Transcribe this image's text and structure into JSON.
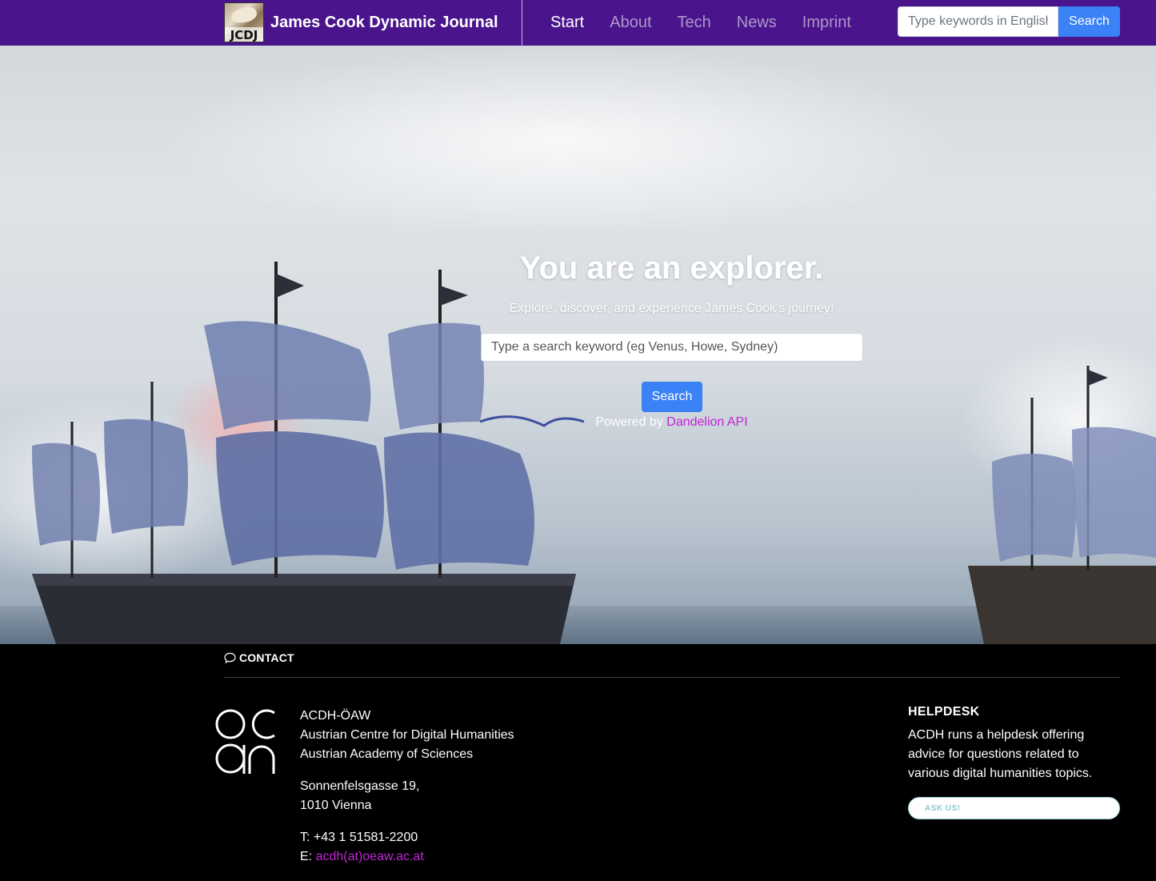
{
  "navbar": {
    "brand_title": "James Cook Dynamic Journal",
    "logo_text": "JCDJ",
    "links": [
      {
        "label": "Start",
        "active": true
      },
      {
        "label": "About",
        "active": false
      },
      {
        "label": "Tech",
        "active": false
      },
      {
        "label": "News",
        "active": false
      },
      {
        "label": "Imprint",
        "active": false
      }
    ],
    "search_placeholder": "Type keywords in English",
    "search_button": "Search",
    "background_color": "#4a148c",
    "button_color": "#3b82f6"
  },
  "hero": {
    "title": "You are an explorer.",
    "subtitle": "Explore, discover, and experience James Cook's journey!",
    "search_placeholder": "Type a search keyword (eg Venus, Howe, Sydney)",
    "search_button": "Search",
    "powered_by_prefix": "Powered by",
    "powered_by_link": "Dandelion API"
  },
  "footer": {
    "contact_heading": "CONTACT",
    "org_lines": [
      "ACDH-ÖAW",
      "Austrian Centre for Digital Humanities",
      "Austrian Academy of Sciences"
    ],
    "address_lines": [
      "Sonnenfelsgasse 19,",
      "1010 Vienna"
    ],
    "phone_label": "T: +43 1 51581-2200",
    "email_prefix": "E:",
    "email_link": "acdh(at)oeaw.ac.at",
    "helpdesk_heading": "HELPDESK",
    "helpdesk_text": "ACDH runs a helpdesk offering advice for questions related to various digital humanities topics.",
    "helpdesk_button": "ASK US!",
    "link_color": "#c026d3"
  }
}
